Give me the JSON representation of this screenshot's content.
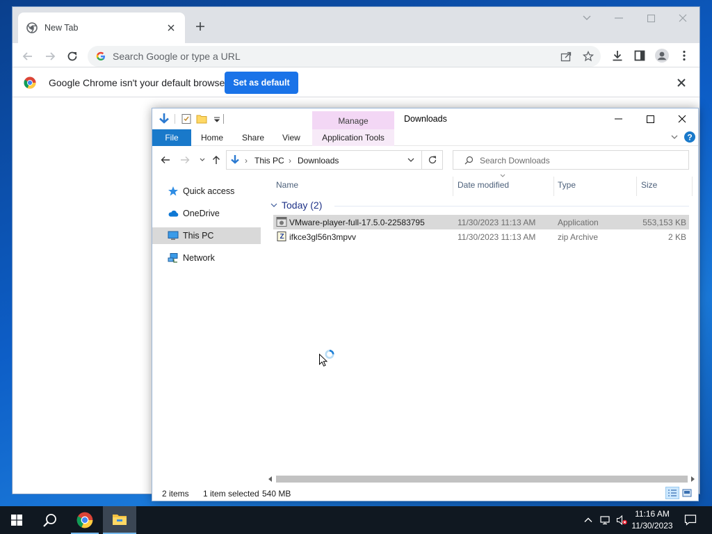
{
  "browser": {
    "tab_title": "New Tab",
    "omnibox_placeholder": "Search Google or type a URL",
    "infobar_message": "Google Chrome isn't your default browser",
    "set_default_label": "Set as default"
  },
  "explorer": {
    "window_title": "Downloads",
    "contextual_tab_group": "Manage",
    "ribbon_tabs": [
      "File",
      "Home",
      "Share",
      "View",
      "Application Tools"
    ],
    "breadcrumb": [
      "This PC",
      "Downloads"
    ],
    "search_placeholder": "Search Downloads",
    "nav_items": [
      "Quick access",
      "OneDrive",
      "This PC",
      "Network"
    ],
    "selected_nav": "This PC",
    "columns": [
      "Name",
      "Date modified",
      "Type",
      "Size"
    ],
    "group_label": "Today (2)",
    "files": [
      {
        "name": "VMware-player-full-17.5.0-22583795",
        "date": "11/30/2023 11:13 AM",
        "type": "Application",
        "size": "553,153 KB",
        "selected": true
      },
      {
        "name": "ifkce3gl56n3mpvv",
        "date": "11/30/2023 11:13 AM",
        "type": "zip Archive",
        "size": "2 KB",
        "selected": false
      }
    ],
    "status": {
      "item_count": "2 items",
      "selection": "1 item selected",
      "selection_size": "540 MB"
    }
  },
  "taskbar": {
    "time": "11:16 AM",
    "date": "11/30/2023"
  },
  "colors": {
    "chrome_blue": "#1a73e8",
    "explorer_file_tab": "#1979ca",
    "manage_tab": "#f3d7f5",
    "selection_gray": "#d9d9d9",
    "taskbar": "#101821"
  }
}
